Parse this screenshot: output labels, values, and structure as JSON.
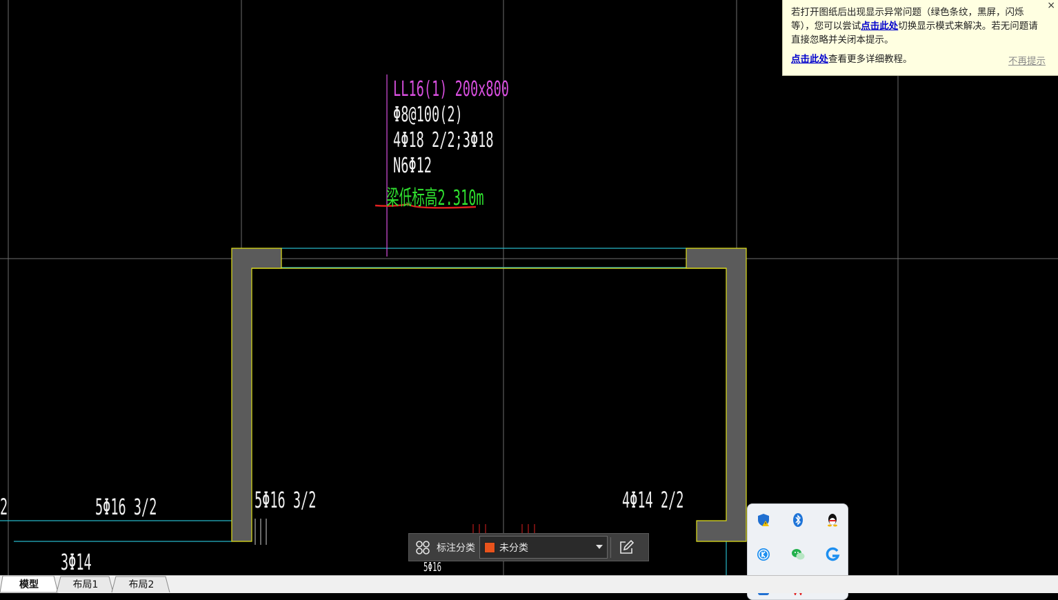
{
  "notice": {
    "line1_prefix": "若打开图纸后出现显示异常问题（绿色条纹，黑屏，闪烁等），您可以尝试",
    "link1": "点击此处",
    "line1_suffix": "切换显示模式来解决。若无问题请直接忽略并关闭本提示。",
    "link2": "点击此处",
    "more_suffix": "查看更多详细教程。",
    "no_more": "不再提示",
    "close_glyph": "×"
  },
  "drawing": {
    "beam_label": "LL16(1) 200x800",
    "stirrup": "Φ8@100(2)",
    "main_bars": "4Φ18 2/2;3Φ18",
    "waist_bars": "N6Φ12",
    "elevation_prefix": "梁低标高",
    "elevation_value": "2.310m",
    "left_bars": "5Φ16 3/2",
    "inner_left_bars": "5Φ16 3/2",
    "inner_right_bars": "4Φ14 2/2",
    "bottom_left_bars": "3Φ14",
    "bottom_mid_bars": "5Φ16",
    "edge_fragment": "2"
  },
  "annotation_bar": {
    "label": "标注分类",
    "selected": "未分类",
    "swatch_color": "#e8531c"
  },
  "tabs": [
    "模型",
    "布局1",
    "布局2"
  ],
  "tray": {
    "icons": [
      "security-warning-icon",
      "bluetooth-icon",
      "qq-icon",
      "kugou-icon",
      "wechat-icon",
      "browser-icon",
      "app-icon",
      "wps-icon"
    ]
  },
  "colors": {
    "background": "#000000",
    "cyan": "#27b8c9",
    "yellow": "#e3e31a",
    "magenta": "#d94fe0",
    "green": "#2fe02f",
    "red": "#e02020",
    "column_fill": "#5b5b5b"
  }
}
